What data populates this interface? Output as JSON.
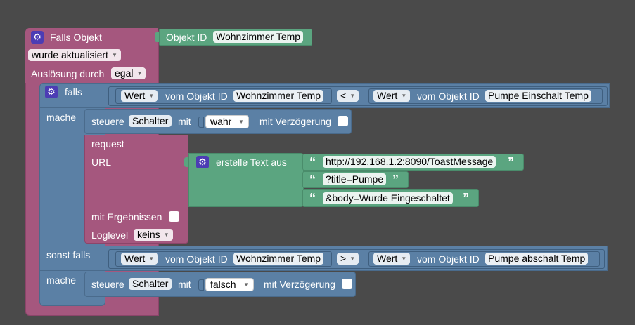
{
  "trigger": {
    "title": "Falls Objekt",
    "object_id_label": "Objekt ID",
    "object_id_value": "Wohnzimmer Temp",
    "condition": "wurde aktualisiert",
    "source_label": "Auslösung durch",
    "source_value": "egal"
  },
  "if_block": {
    "if_label": "falls",
    "do_label": "mache",
    "else_if_label": "sonst falls",
    "do2_label": "mache"
  },
  "cond1": {
    "left_type": "Wert",
    "left_label": "vom Objekt ID",
    "left_id": "Wohnzimmer Temp",
    "operator": "<",
    "right_type": "Wert",
    "right_label": "vom Objekt ID",
    "right_id": "Pumpe Einschalt Temp"
  },
  "cond2": {
    "left_type": "Wert",
    "left_label": "vom Objekt ID",
    "left_id": "Wohnzimmer Temp",
    "operator": ">",
    "right_type": "Wert",
    "right_label": "vom Objekt ID",
    "right_id": "Pumpe abschalt Temp"
  },
  "set1": {
    "label": "steuere",
    "target": "Schalter",
    "with": "mit",
    "value": "wahr",
    "delay": "mit Verzögerung"
  },
  "request": {
    "label": "request",
    "url_label": "URL",
    "results_label": "mit Ergebnissen",
    "loglevel_label": "Loglevel",
    "loglevel_value": "keins"
  },
  "text_join": {
    "label": "erstelle Text aus",
    "parts": [
      "http://192.168.1.2:8090/ToastMessage",
      "?title=Pumpe",
      "&body=Wurde Eingeschaltet"
    ],
    "open_quote": "“",
    "close_quote": "”"
  },
  "set2": {
    "label": "steuere",
    "target": "Schalter",
    "with": "mit",
    "value": "falsch",
    "delay": "mit Verzögerung"
  },
  "colors": {
    "event": "#a5577e",
    "logic": "#5b80a5",
    "text": "#5ba580",
    "background": "#4a4a4a"
  }
}
